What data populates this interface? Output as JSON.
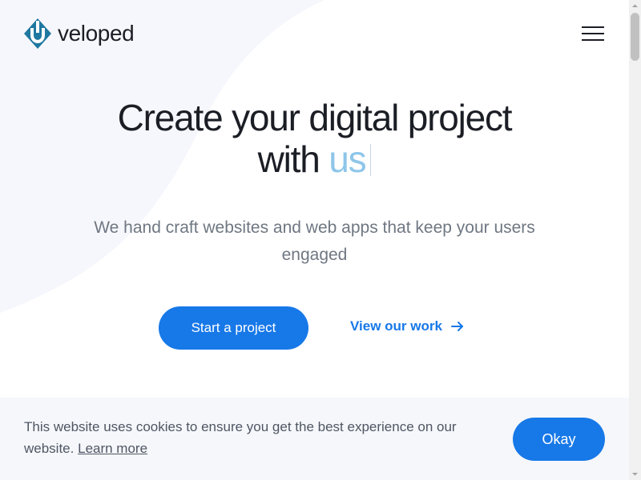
{
  "header": {
    "brand": "veloped",
    "logo_letter": "U",
    "menu_icon": "hamburger-menu-icon"
  },
  "hero": {
    "title_line_1": "Create your digital project",
    "title_line_2_prefix": "with ",
    "title_line_2_accent": "us",
    "subtitle": "We hand craft websites and web apps that keep your users engaged",
    "primary_button": "Start a project",
    "secondary_link": "View our work",
    "secondary_icon": "arrow-right-icon"
  },
  "cookie": {
    "message": "This website uses cookies to ensure you get the best experience on our website.",
    "learn_more": "Learn more",
    "okay_button": "Okay"
  },
  "colors": {
    "brand_blue": "#1778e8",
    "accent_light_blue": "#8ec6e9",
    "logo_teal": "#1f78a0",
    "text_dark": "#1b1e25",
    "text_muted": "#6f7782",
    "cookie_background": "#f5f7fb",
    "scrollbar_track": "#f1f1f1",
    "scrollbar_thumb": "#c1c1c1"
  },
  "scrollbar": {
    "position_percent": 0
  }
}
